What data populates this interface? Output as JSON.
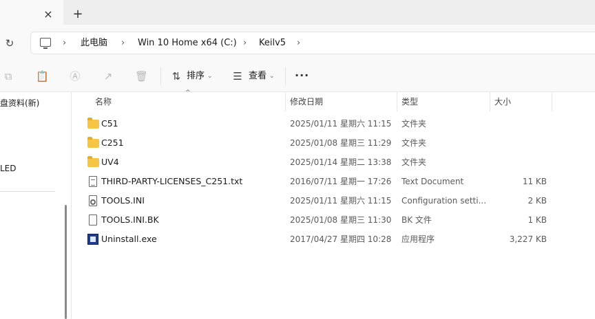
{
  "tabs": {
    "close_icon": "×",
    "new_tab_icon": "+"
  },
  "address_bar": {
    "refresh_icon": "↻",
    "breadcrumbs": [
      "此电脑",
      "Win 10 Home x64 (C:)",
      "Keilv5"
    ],
    "separator": "›"
  },
  "toolbar": {
    "sort_label": "排序",
    "view_label": "查看",
    "more_label": "···"
  },
  "sidebar": {
    "items": [
      "金盘资料(新)",
      "大LED"
    ]
  },
  "file_list": {
    "columns": [
      "名称",
      "修改日期",
      "类型",
      "大小"
    ],
    "sort_indicator": "^",
    "rows": [
      {
        "name": "C51",
        "modified": "2025/01/11 星期六 11:15",
        "type": "文件夹",
        "size": "",
        "icon": "folder-icon"
      },
      {
        "name": "C251",
        "modified": "2025/01/08 星期三 11:29",
        "type": "文件夹",
        "size": "",
        "icon": "folder-icon"
      },
      {
        "name": "UV4",
        "modified": "2025/01/14 星期二 13:38",
        "type": "文件夹",
        "size": "",
        "icon": "folder-icon"
      },
      {
        "name": "THIRD-PARTY-LICENSES_C251.txt",
        "modified": "2016/07/11 星期一 17:26",
        "type": "Text Document",
        "size": "11 KB",
        "icon": "text-file-icon"
      },
      {
        "name": "TOOLS.INI",
        "modified": "2025/01/11 星期六 11:15",
        "type": "Configuration setti...",
        "size": "2 KB",
        "icon": "config-file-icon"
      },
      {
        "name": "TOOLS.INI.BK",
        "modified": "2025/01/08 星期三 11:30",
        "type": "BK 文件",
        "size": "1 KB",
        "icon": "file-icon"
      },
      {
        "name": "Uninstall.exe",
        "modified": "2017/04/27 星期四 10:28",
        "type": "应用程序",
        "size": "3,227 KB",
        "icon": "exe-icon"
      }
    ]
  }
}
